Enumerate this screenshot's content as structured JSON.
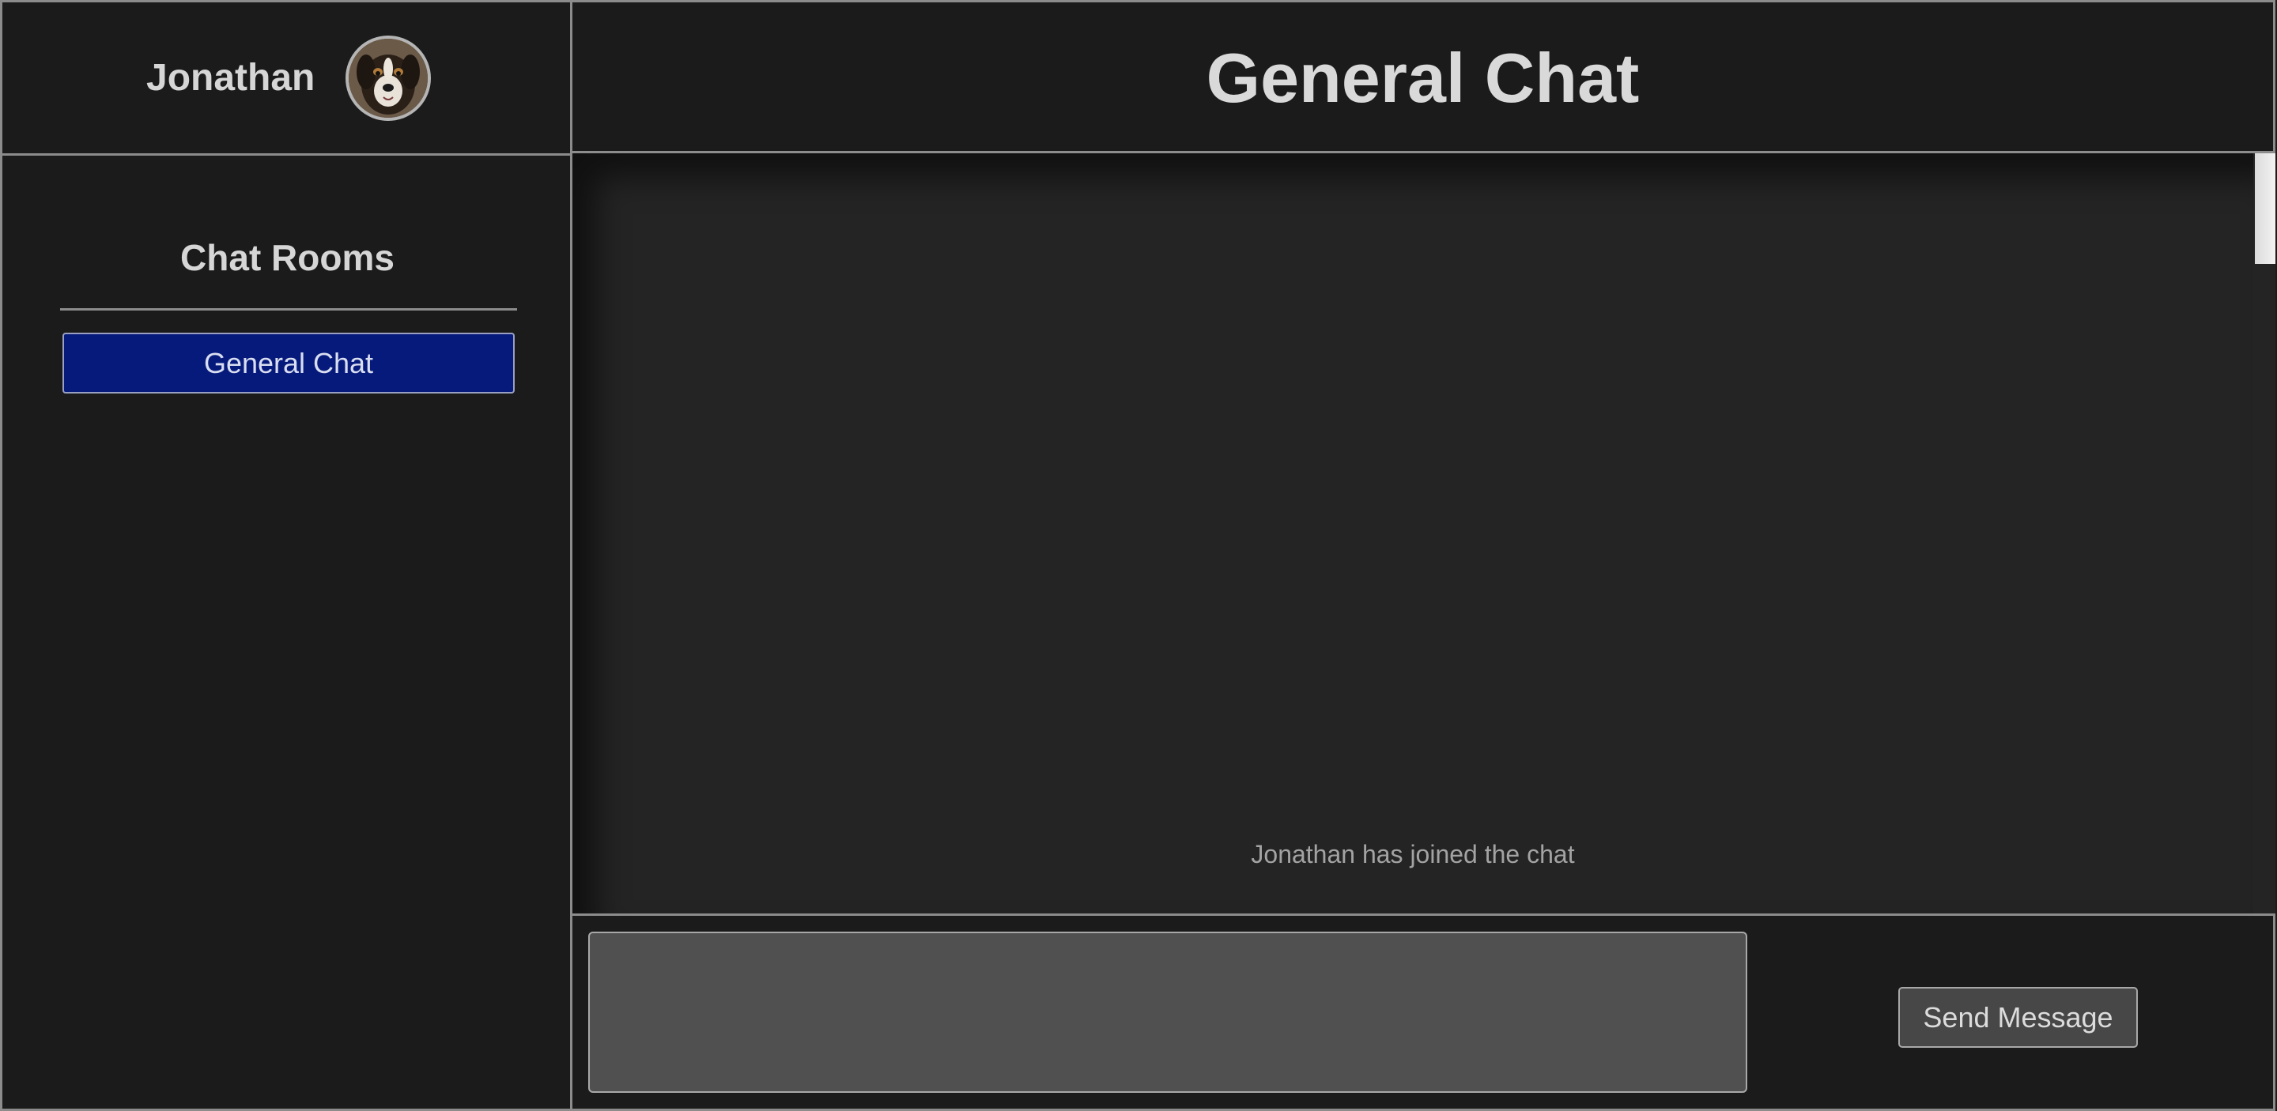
{
  "user": {
    "name": "Jonathan",
    "avatar_icon": "dog-avatar"
  },
  "sidebar": {
    "title": "Chat Rooms",
    "rooms": [
      {
        "label": "General Chat",
        "active": true
      }
    ]
  },
  "main": {
    "title": "General Chat",
    "messages": [
      {
        "type": "system",
        "text": "Jonathan has joined the chat"
      }
    ]
  },
  "composer": {
    "input_value": "",
    "send_label": "Send Message"
  },
  "colors": {
    "background": "#1b1b1b",
    "panel": "#242424",
    "border": "#8c8c8c",
    "active_room": "#061a7c",
    "input_bg": "#505050",
    "button_bg": "#474747"
  }
}
